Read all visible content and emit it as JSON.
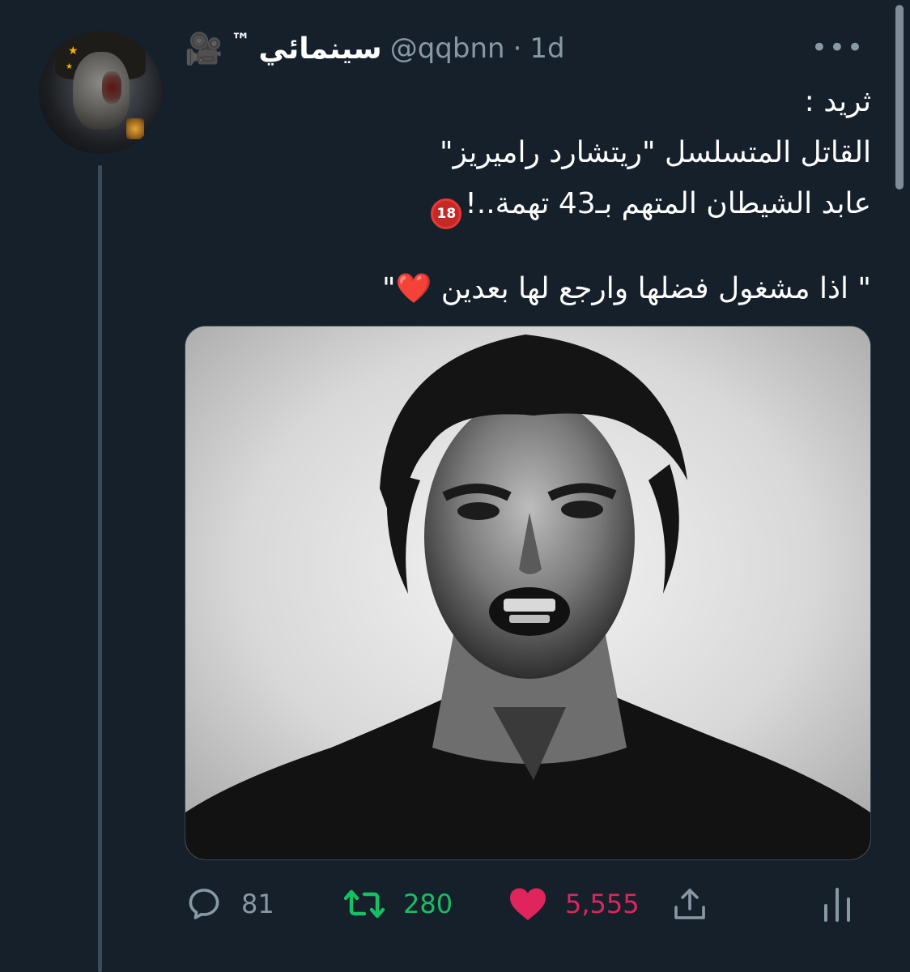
{
  "tweet": {
    "display_name": "سينمائي",
    "trademark": "™",
    "handle": "@qqbnn",
    "separator": "·",
    "time": "1d",
    "text": {
      "line1": "ثريد :",
      "line2": "القاتل المتسلسل \"ريتشارد راميريز\"",
      "line3": "عابد الشيطان المتهم بـ43 تهمة..!",
      "line3_badge": "18",
      "line4_before": "\" اذا مشغول فضلها وارجع لها بعدين ",
      "line4_heart": "❤️",
      "line4_after": "\""
    }
  },
  "actions": {
    "reply_count": "81",
    "retweet_count": "280",
    "like_count": "5,555"
  },
  "icons": {
    "camera": "movie-camera-icon",
    "more": "more-options-icon",
    "reply": "reply-icon",
    "retweet": "retweet-icon",
    "like": "heart-icon",
    "share": "share-icon",
    "analytics": "analytics-icon"
  },
  "colors": {
    "background": "#15202b",
    "secondary_text": "#8899a6",
    "retweet": "#17bf63",
    "like": "#e0245e"
  }
}
